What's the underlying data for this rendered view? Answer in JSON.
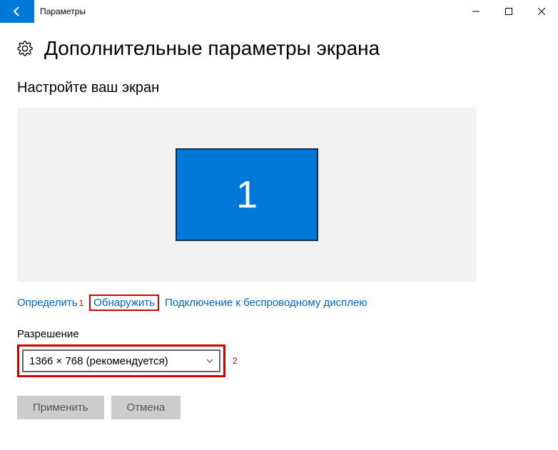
{
  "titlebar": {
    "title": "Параметры"
  },
  "page": {
    "heading": "Дополнительные параметры экрана"
  },
  "section": {
    "customize": "Настройте ваш экран"
  },
  "monitor": {
    "number": "1"
  },
  "links": {
    "identify": "Определить",
    "detect": "Обнаружить",
    "wireless": "Подключение к беспроводному дисплею"
  },
  "annotations": {
    "one": "1",
    "two": "2"
  },
  "resolution": {
    "label": "Разрешение",
    "value": "1366 × 768 (рекомендуется)"
  },
  "buttons": {
    "apply": "Применить",
    "cancel": "Отмена"
  }
}
